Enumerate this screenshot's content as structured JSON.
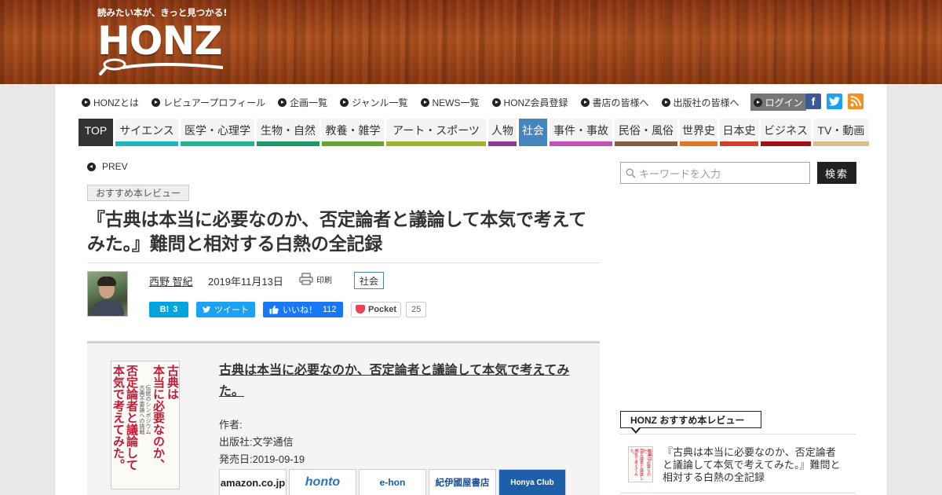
{
  "header": {
    "tagline": "読みたい本が、きっと見つかる!",
    "logo_text": "HONZ"
  },
  "top_nav": [
    {
      "label": "HONZとは"
    },
    {
      "label": "レビュアープロフィール"
    },
    {
      "label": "企画一覧"
    },
    {
      "label": "ジャンル一覧"
    },
    {
      "label": "NEWS一覧"
    },
    {
      "label": "HONZ会員登録"
    },
    {
      "label": "書店の皆様へ"
    },
    {
      "label": "出版社の皆様へ"
    },
    {
      "label": "ログイン"
    }
  ],
  "social": {
    "facebook": "f",
    "twitter": "t",
    "rss": "rss"
  },
  "categories": [
    {
      "label": "TOP",
      "color": "#333333"
    },
    {
      "label": "サイエンス",
      "color": "#1fb3c4"
    },
    {
      "label": "医学・心理学",
      "color": "#26b495"
    },
    {
      "label": "生物・自然",
      "color": "#1a9865"
    },
    {
      "label": "教養・雑学",
      "color": "#67a232"
    },
    {
      "label": "アート・スポーツ",
      "color": "#9fb330"
    },
    {
      "label": "人物",
      "color": "#8d3d95"
    },
    {
      "label": "社会",
      "color": "#4585bd"
    },
    {
      "label": "事件・事故",
      "color": "#c451b8"
    },
    {
      "label": "民俗・風俗",
      "color": "#8b5e3b"
    },
    {
      "label": "世界史",
      "color": "#e0742a"
    },
    {
      "label": "日本史",
      "color": "#d0402b"
    },
    {
      "label": "ビジネス",
      "color": "#a21118"
    },
    {
      "label": "TV・動画",
      "color": "#d9bf8b"
    }
  ],
  "article": {
    "prev_label": "PREV",
    "category_badge": "おすすめ本レビュー",
    "title": "『古典は本当に必要なのか、否定論者と議論して本気で考えてみた。』難問と相対する白熱の全記録",
    "author": "西野 智紀",
    "date": "2019年11月13日",
    "print_label": "印刷",
    "tag": "社会"
  },
  "share": {
    "hatena_label": "B!",
    "hatena_count": "3",
    "tweet_label": "ツイート",
    "like_label": "いいね！",
    "like_count": "112",
    "pocket_label": "Pocket",
    "pocket_count": "25"
  },
  "book": {
    "title": "古典は本当に必要なのか、否定論者と議論して本気で考えてみた。",
    "author_label": "作者:",
    "publisher": "出版社:文学通信",
    "release": "発売日:2019-09-19",
    "cover_big": [
      "古典は",
      "本当に必要なのか、",
      "否定論者と議論して",
      "本気で考えてみた。"
    ],
    "cover_small": [
      "伝統のシンポジウム",
      "古典不要論への挑戦"
    ],
    "stores": [
      {
        "label": "amazon.co.jp"
      },
      {
        "label": "honto"
      },
      {
        "label": "e-hon"
      },
      {
        "label": "紀伊國屋書店"
      },
      {
        "label": "Honya Club"
      }
    ]
  },
  "sidebar": {
    "search_placeholder": "キーワードを入力",
    "search_button": "検索",
    "rec_heading": "HONZ おすすめ本レビュー",
    "rec_item_title": "『古典は本当に必要なのか、否定論者と議論して本気で考えてみた。』難問と相対する白熱の全記録"
  }
}
